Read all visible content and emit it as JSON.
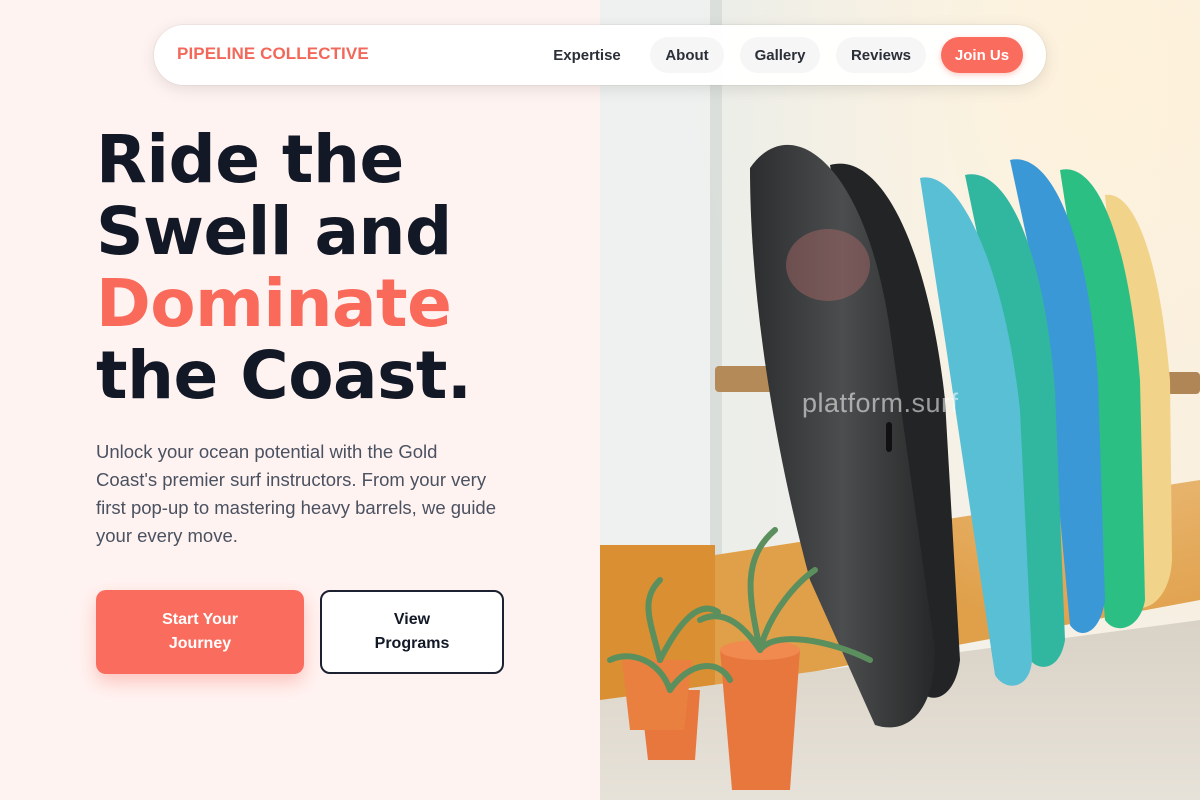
{
  "brand": {
    "name": "PIPELINE COLLECTIVE",
    "accent_color": "#f2685a"
  },
  "nav": {
    "items": [
      {
        "label": "Expertise"
      },
      {
        "label": "About"
      },
      {
        "label": "Gallery"
      },
      {
        "label": "Reviews"
      }
    ],
    "cta_label": "Join Us"
  },
  "hero": {
    "headline": {
      "line1": "Ride the",
      "line2": "Swell and",
      "line3_accent": "Dominate",
      "line4": "the Coast."
    },
    "description": "Unlock your ocean potential with the Gold Coast's premier surf instructors. From your very first pop-up to mastering heavy barrels, we guide your every move.",
    "primary_button": "Start Your Journey",
    "secondary_button": "View Programs"
  },
  "image": {
    "watermark": "platform.surf",
    "subject": "surfboards"
  },
  "colors": {
    "accent": "#fa6a5b",
    "heading": "#121826",
    "body_text": "#4a5160",
    "background": "#fff3f1"
  }
}
